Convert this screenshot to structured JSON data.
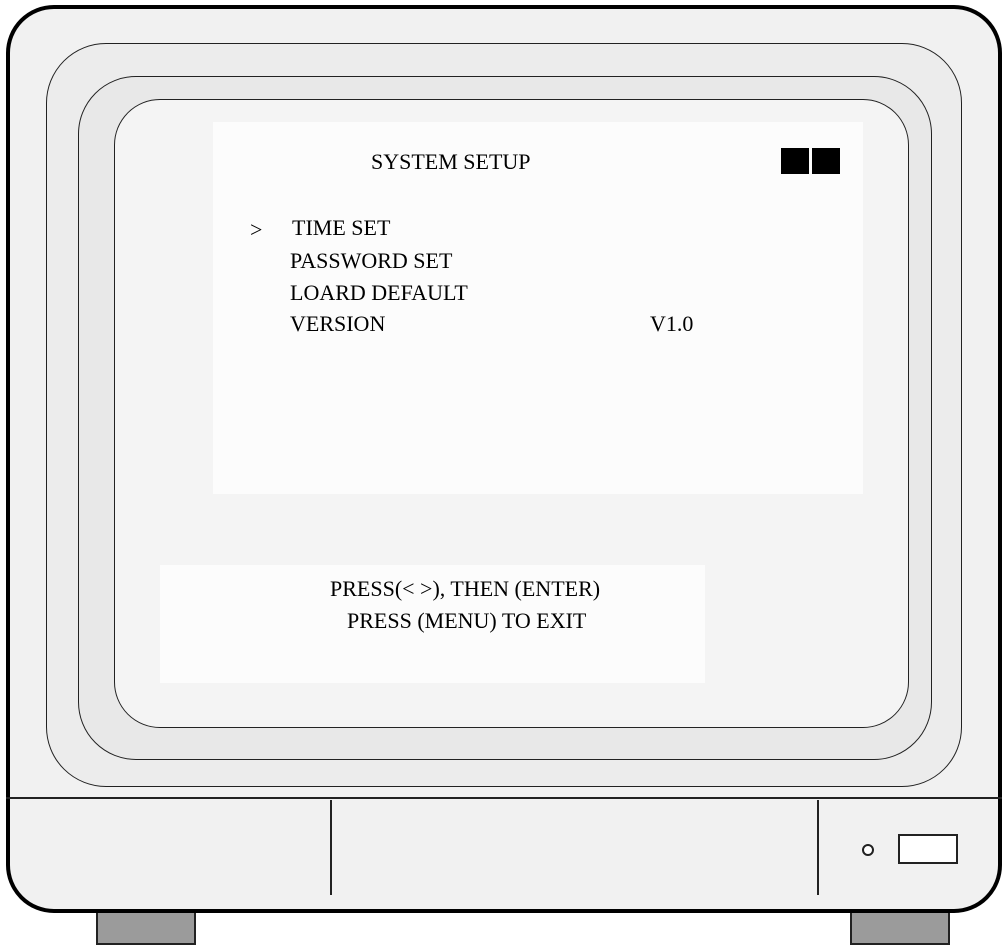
{
  "osd": {
    "title": "SYSTEM SETUP",
    "cursor": ">",
    "menu": [
      {
        "label": "TIME SET",
        "value": ""
      },
      {
        "label": "PASSWORD SET",
        "value": ""
      },
      {
        "label": "LOARD DEFAULT",
        "value": ""
      },
      {
        "label": "VERSION",
        "value": "V1.0"
      }
    ],
    "hints": [
      "PRESS(< >), THEN (ENTER)",
      "PRESS (MENU) TO EXIT"
    ],
    "status_indicator_icon": "two-solid-blocks"
  },
  "device": {
    "power_led_icon": "circle-led",
    "power_button_icon": "rectangle-button"
  },
  "colors": {
    "text": "#000000",
    "screen": "#fcfcfc",
    "bezel": "#ececec",
    "foot": "#9b9b9b"
  }
}
